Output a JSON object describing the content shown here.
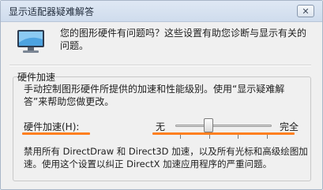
{
  "window": {
    "title": "显示适配器疑难解答",
    "close_label": "✕"
  },
  "intro": {
    "text": "您的图形硬件有问题吗？这些设置有助您诊断与显示有关的问题。"
  },
  "group": {
    "title": "硬件加速",
    "description": "手动控制图形硬件所提供的加速和性能级别。使用“显示疑难解答”来帮助您做更改。",
    "accel_label": "硬件加速(H):",
    "slider": {
      "left_label": "无",
      "right_label": "完全",
      "value": 0.33
    },
    "detail": "禁用所有 DirectDraw 和 Direct3D 加速，以及所有光标和高级绘图加速。使用这个设置以纠正 DirectX 加速应用程序的严重问题。"
  },
  "colors": {
    "highlight": "#ff7f1f",
    "titlebar": "#d6e1ef"
  },
  "icons": {
    "monitor": "monitor-icon",
    "close": "close-icon"
  }
}
